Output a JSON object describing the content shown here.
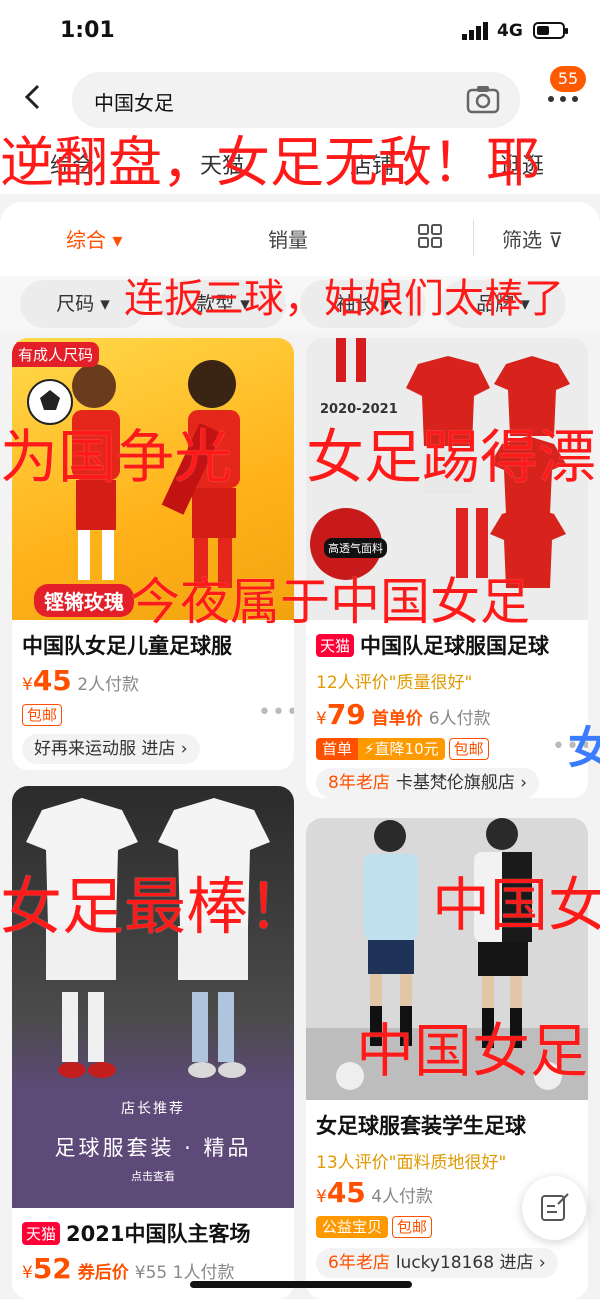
{
  "status": {
    "time": "1:01",
    "network": "4G"
  },
  "header": {
    "search_query": "中国女足",
    "cart_badge": "55",
    "tabs": [
      "综合",
      "天猫",
      "店铺",
      "逛逛"
    ]
  },
  "sort": {
    "items": [
      "综合",
      "销量",
      "筛选"
    ]
  },
  "filters": [
    "尺码",
    "款型",
    "袖长",
    "品牌"
  ],
  "products": [
    {
      "title": "中国队女足儿童足球服",
      "image_corner_label": "有成人尺码",
      "image_caption": "铿锵玫瑰",
      "price_currency": "¥",
      "price": "45",
      "sales": "2人付款",
      "tags": [
        "包邮"
      ],
      "shop": "好再来运动服 进店 ›"
    },
    {
      "badge": "天猫",
      "title": "中国队足球服国足球",
      "image_season": "2020-2021",
      "image_fabric": "高透气面料",
      "review": "12人评价\"质量很好\"",
      "price_currency": "¥",
      "price": "79",
      "price_tag": "首单价",
      "sales": "6人付款",
      "promo_first": "首单",
      "promo_discount": "⚡直降10元",
      "tags": [
        "包邮"
      ],
      "shop_age": "8年老店",
      "shop": "卡基梵伦旗舰店 ›"
    },
    {
      "image_recommend": "店长推荐",
      "image_slogan": "足球服套装 · 精品",
      "image_click": "点击查看",
      "badge": "天猫",
      "title": "2021中国队主客场",
      "price_currency": "¥",
      "price": "52",
      "price_tag": "券后价",
      "price_old": "¥55",
      "sales": "1人付款"
    },
    {
      "title": "女足球服套装学生足球",
      "review": "13人评价\"面料质地很好\"",
      "price_currency": "¥",
      "price": "45",
      "sales": "4人付款",
      "promo_charity": "公益宝贝",
      "tags": [
        "包邮"
      ],
      "shop_age": "6年老店",
      "shop": "lucky18168 进店 ›"
    }
  ],
  "danmu": [
    "逆翻盘，女足无敌！耶",
    "连扳三球，姑娘们太棒了",
    "为国争光",
    "女足踢得漂",
    "今夜属于中国女足",
    "女足最棒！",
    "中国女",
    "中国女足"
  ],
  "side_label": "女",
  "colors": {
    "accent": "#ff5000",
    "tmall": "#ff0036",
    "danmu": "#ff1a1a"
  }
}
